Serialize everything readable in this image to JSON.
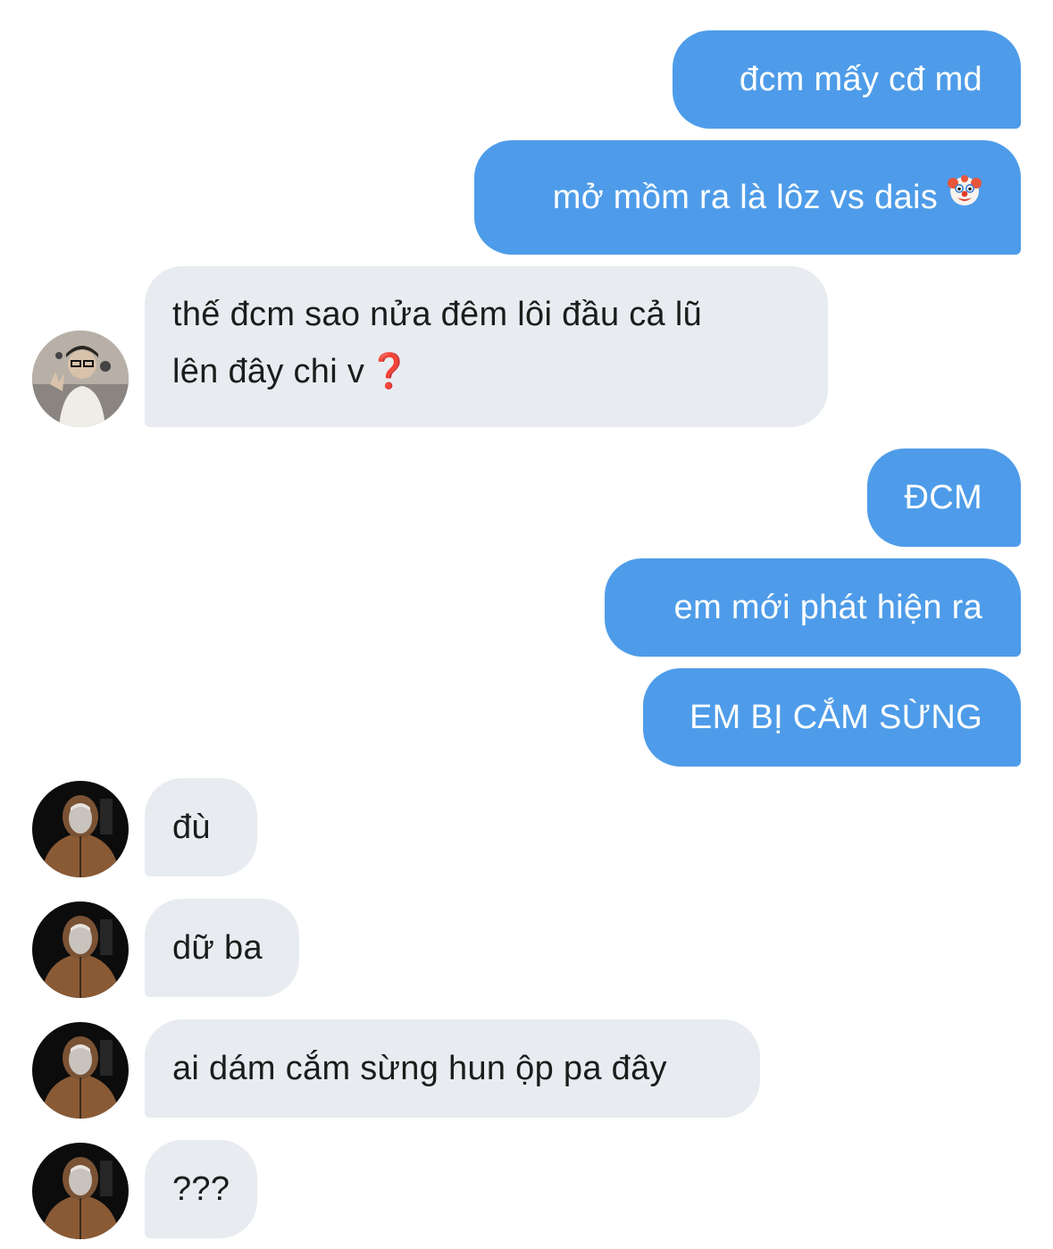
{
  "messages": [
    {
      "side": "sent",
      "text": "đcm mấy cđ md"
    },
    {
      "side": "sent",
      "text": "mở mồm ra là lôz vs dais",
      "emoji": "clown-face-icon"
    },
    {
      "side": "received",
      "line1": "thế đcm sao nửa đêm lôi đầu cả lũ",
      "line2": "lên đây chi v",
      "suffix": "❓",
      "avatar": "avatar-person-glasses"
    },
    {
      "side": "sent",
      "text": "ĐCM"
    },
    {
      "side": "sent",
      "text": "em mới phát hiện ra"
    },
    {
      "side": "sent",
      "text": "EM BỊ CẮM SỪNG"
    },
    {
      "side": "received",
      "text": "đù",
      "avatar": "avatar-person-hoodie"
    },
    {
      "side": "received",
      "text": "dữ ba",
      "avatar": "avatar-person-hoodie"
    },
    {
      "side": "received",
      "text": "ai dám cắm sừng hun ộp pa đây",
      "avatar": "avatar-person-hoodie"
    },
    {
      "side": "received",
      "text": "???",
      "avatar": "avatar-person-hoodie"
    }
  ],
  "colors": {
    "sent_bubble": "#4e9ce9",
    "received_bubble": "#e8ecf0",
    "background": "#ffffff"
  }
}
